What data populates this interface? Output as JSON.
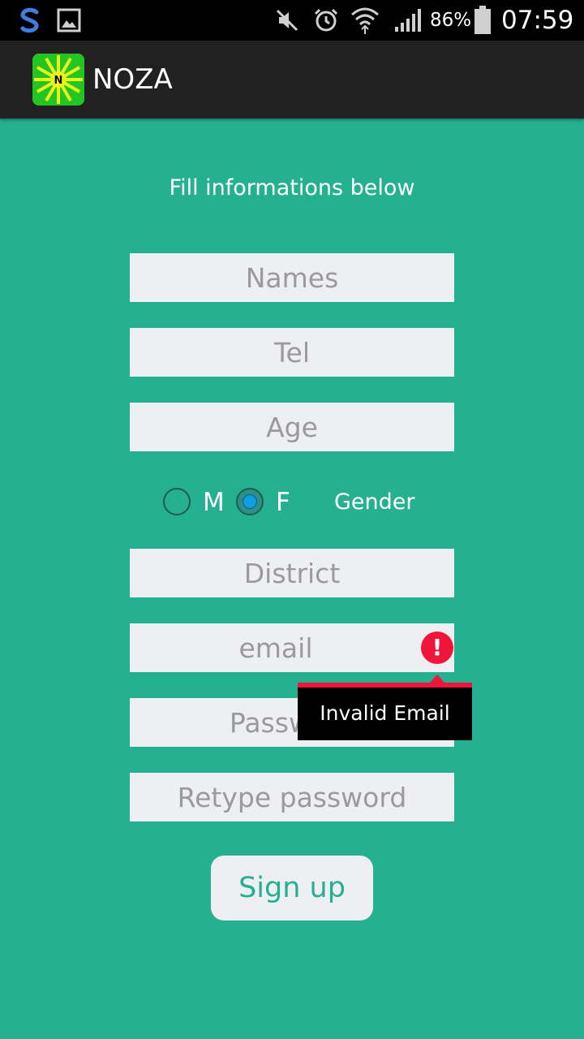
{
  "status_bar": {
    "battery": "86%",
    "time": "07:59",
    "icons": [
      "s-app-icon",
      "gallery-icon",
      "mute-icon",
      "alarm-icon",
      "wifi-icon",
      "signal-icon",
      "battery-icon"
    ]
  },
  "app_bar": {
    "logo_letter": "N",
    "title": "NOZA"
  },
  "form": {
    "instruction": "Fill informations below",
    "names_placeholder": "Names",
    "tel_placeholder": "Tel",
    "age_placeholder": "Age",
    "gender": {
      "option_m": "M",
      "option_f": "F",
      "label": "Gender",
      "selected": "F"
    },
    "district_placeholder": "District",
    "email_placeholder": "email",
    "email_error": "Invalid Email",
    "password_placeholder": "Password",
    "retype_placeholder": "Retype password",
    "submit_label": "Sign up"
  },
  "colors": {
    "background": "#25b08f",
    "app_bar": "#212121",
    "field": "#eeeff2",
    "error": "#f0163b"
  }
}
